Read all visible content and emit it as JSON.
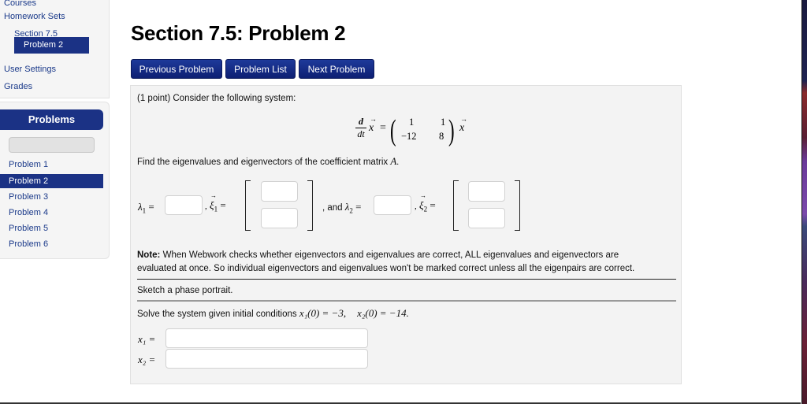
{
  "sidebar": {
    "nav": {
      "courses": "Courses",
      "homework_sets": "Homework Sets",
      "section": "Section 7.5",
      "problem": "Problem 2",
      "user_settings": "User Settings",
      "grades": "Grades"
    },
    "problems_panel": {
      "title": "Problems",
      "items": [
        "Problem 1",
        "Problem 2",
        "Problem 3",
        "Problem 4",
        "Problem 5",
        "Problem 6"
      ],
      "active_index": 1
    }
  },
  "header": {
    "title": "Section 7.5: Problem 2",
    "buttons": {
      "previous": "Previous Problem",
      "list": "Problem List",
      "next": "Next Problem"
    }
  },
  "problem": {
    "intro": "(1 point) Consider the following system:",
    "equation": {
      "d": "d",
      "dt": "dt",
      "x": "x",
      "eq": "=",
      "matrix": [
        [
          "1",
          "1"
        ],
        [
          "−12",
          "8"
        ]
      ]
    },
    "find_text": "Find the eigenvalues and eigenvectors of the coefficient matrix ",
    "find_var": "A",
    "find_end": ".",
    "lambda1_label": "λ",
    "lambda1_sub": "1",
    "xi1_label": "ξ",
    "xi1_sub": "1",
    "and_text": ", and ",
    "lambda2_sub": "2",
    "xi2_sub": "2",
    "equals": "=",
    "comma": ",",
    "inputs": {
      "lambda1": "",
      "xi1_top": "",
      "xi1_bottom": "",
      "lambda2": "",
      "xi2_top": "",
      "xi2_bottom": "",
      "x1": "",
      "x2": ""
    },
    "note_bold": "Note:",
    "note_line1": " When Webwork checks whether eigenvectors and eigenvalues are correct, ALL eigenvalues and eigenvectors are",
    "note_line2": "evaluated at once. So individual eigenvectors and eigenvalues won't be marked correct unless all the eigenpairs are correct.",
    "sketch": "Sketch a phase portrait.",
    "solve_text": "Solve the system given initial conditions ",
    "ic1": "x₁(0) = −3,",
    "ic2": "x₂(0) = −14.",
    "x1_label": "x₁ =",
    "x2_label": "x₂ ="
  }
}
